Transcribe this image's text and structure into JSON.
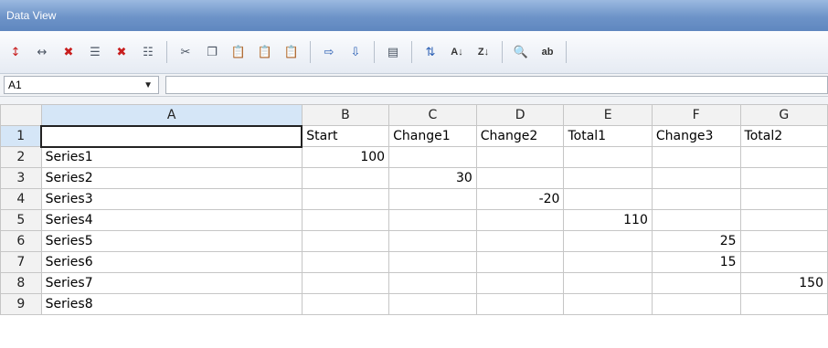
{
  "window": {
    "title": "Data View"
  },
  "toolbar": {
    "icons": [
      "insert-row-icon",
      "insert-column-icon",
      "delete-row-icon",
      "insert-rows-icon",
      "delete-column-icon",
      "insert-columns-icon",
      "cut-icon",
      "copy-icon",
      "paste-icon",
      "paste-special-icon",
      "paste-values-icon",
      "import-icon",
      "export-icon",
      "properties-icon",
      "switch-row-column-icon",
      "sort-ascending-icon",
      "sort-descending-icon",
      "find-icon",
      "replace-icon"
    ]
  },
  "formula_bar": {
    "cell_ref": "A1",
    "formula": ""
  },
  "grid": {
    "columns": [
      "A",
      "B",
      "C",
      "D",
      "E",
      "F",
      "G"
    ],
    "rows": [
      {
        "num": "1",
        "cells": [
          "",
          "Start",
          "Change1",
          "Change2",
          "Total1",
          "Change3",
          "Total2"
        ]
      },
      {
        "num": "2",
        "cells": [
          "Series1",
          "100",
          "",
          "",
          "",
          "",
          ""
        ]
      },
      {
        "num": "3",
        "cells": [
          "Series2",
          "",
          "30",
          "",
          "",
          "",
          ""
        ]
      },
      {
        "num": "4",
        "cells": [
          "Series3",
          "",
          "",
          "-20",
          "",
          "",
          ""
        ]
      },
      {
        "num": "5",
        "cells": [
          "Series4",
          "",
          "",
          "",
          "110",
          "",
          ""
        ]
      },
      {
        "num": "6",
        "cells": [
          "Series5",
          "",
          "",
          "",
          "",
          "25",
          ""
        ]
      },
      {
        "num": "7",
        "cells": [
          "Series6",
          "",
          "",
          "",
          "",
          "15",
          ""
        ]
      },
      {
        "num": "8",
        "cells": [
          "Series7",
          "",
          "",
          "",
          "",
          "",
          "150"
        ]
      },
      {
        "num": "9",
        "cells": [
          "Series8",
          "",
          "",
          "",
          "",
          "",
          ""
        ]
      }
    ]
  }
}
